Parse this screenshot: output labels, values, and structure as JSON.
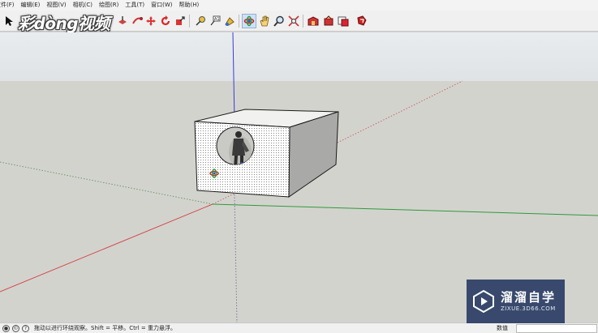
{
  "menubar": {
    "items": [
      "文件(F)",
      "编辑(E)",
      "视图(V)",
      "相机(C)",
      "绘图(R)",
      "工具(T)",
      "窗口(W)",
      "帮助(H)"
    ]
  },
  "toolbar": {
    "tools": [
      {
        "name": "select-tool",
        "icon": "arrow-cursor-icon"
      },
      {
        "name": "make-component-tool",
        "icon": "component-icon"
      },
      {
        "name": "paint-bucket-tool",
        "icon": "paint-bucket-icon"
      },
      {
        "name": "eraser-tool",
        "icon": "eraser-icon"
      },
      {
        "name": "rectangle-tool",
        "icon": "rectangle-icon"
      },
      {
        "name": "line-tool",
        "icon": "pencil-icon"
      },
      {
        "name": "circle-tool",
        "icon": "circle-icon"
      },
      {
        "name": "arc-tool",
        "icon": "arc-icon"
      },
      {
        "name": "polygon-tool",
        "icon": "polygon-icon"
      },
      {
        "name": "freehand-tool",
        "icon": "freehand-icon"
      },
      {
        "name": "move-tool",
        "icon": "move-icon"
      },
      {
        "name": "push-pull-tool",
        "icon": "push-pull-icon"
      },
      {
        "name": "rotate-tool",
        "icon": "rotate-icon"
      },
      {
        "name": "follow-me-tool",
        "icon": "follow-me-icon"
      },
      {
        "name": "scale-tool",
        "icon": "scale-icon"
      },
      {
        "name": "offset-tool",
        "icon": "offset-icon"
      },
      {
        "name": "tape-measure-tool",
        "icon": "tape-measure-icon"
      },
      {
        "name": "text-tool",
        "icon": "text-icon"
      },
      {
        "name": "paint-tool",
        "icon": "paint-icon"
      },
      {
        "name": "orbit-tool",
        "icon": "orbit-icon"
      },
      {
        "name": "pan-tool",
        "icon": "pan-hand-icon"
      },
      {
        "name": "zoom-tool",
        "icon": "zoom-icon"
      },
      {
        "name": "zoom-extents-tool",
        "icon": "zoom-extents-icon"
      },
      {
        "name": "warehouse-tool",
        "icon": "warehouse-icon"
      },
      {
        "name": "share-model-tool",
        "icon": "share-model-icon"
      },
      {
        "name": "components-tool",
        "icon": "components-icon"
      },
      {
        "name": "extension-warehouse-tool",
        "icon": "extension-warehouse-icon"
      }
    ],
    "active_tool": "orbit-tool",
    "watermark_text": "彩dòng视频"
  },
  "viewport": {
    "axis_colors": {
      "red": "#d24a4a",
      "green": "#2f9a3a",
      "blue": "#3b3bd6"
    },
    "sky_color": "#e6e9eb",
    "ground_color": "#d3d3ce"
  },
  "statusbar": {
    "hint_text": "拖动以进行环绕观察。Shift = 平移。Ctrl = 重力悬浮。",
    "measurements_label": "数值",
    "measurements_value": ""
  },
  "brand": {
    "name": "溜溜自学",
    "url": "ZIXUE.3D66.COM"
  }
}
